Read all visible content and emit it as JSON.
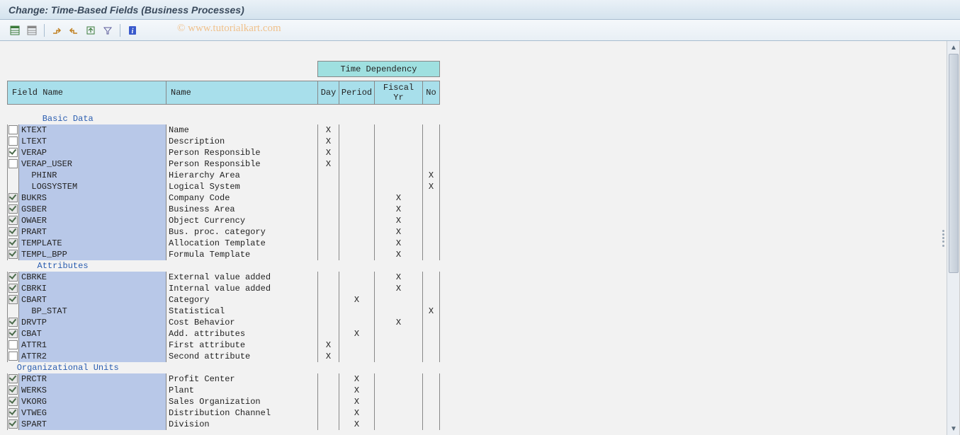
{
  "title": "Change: Time-Based Fields (Business Processes)",
  "watermark": "©   www.tutorialkart.com",
  "headers": {
    "dependency": "Time Dependency",
    "field": "Field Name",
    "name": "Name",
    "day": "Day",
    "period": "Period",
    "fiscal": "Fiscal Yr",
    "no": "No"
  },
  "sections": [
    {
      "title": "Basic Data",
      "indent": "      ",
      "rows": [
        {
          "cb": "unchecked",
          "field": "KTEXT",
          "name": "Name",
          "day": "X",
          "period": "",
          "fy": "",
          "no": ""
        },
        {
          "cb": "unchecked",
          "field": "LTEXT",
          "name": "Description",
          "day": "X",
          "period": "",
          "fy": "",
          "no": ""
        },
        {
          "cb": "checked",
          "field": "VERAP",
          "name": "Person Responsible",
          "day": "X",
          "period": "",
          "fy": "",
          "no": ""
        },
        {
          "cb": "unchecked",
          "field": "VERAP_USER",
          "name": "Person Responsible",
          "day": "X",
          "period": "",
          "fy": "",
          "no": ""
        },
        {
          "cb": "none",
          "field": "  PHINR",
          "name": "Hierarchy Area",
          "day": "",
          "period": "",
          "fy": "",
          "no": "X"
        },
        {
          "cb": "none",
          "field": "  LOGSYSTEM",
          "name": "Logical System",
          "day": "",
          "period": "",
          "fy": "",
          "no": "X"
        },
        {
          "cb": "checked-disabled",
          "field": "BUKRS",
          "name": "Company Code",
          "day": "",
          "period": "",
          "fy": "X",
          "no": ""
        },
        {
          "cb": "checked-disabled",
          "field": "GSBER",
          "name": "Business Area",
          "day": "",
          "period": "",
          "fy": "X",
          "no": ""
        },
        {
          "cb": "checked-disabled",
          "field": "OWAER",
          "name": "Object Currency",
          "day": "",
          "period": "",
          "fy": "X",
          "no": ""
        },
        {
          "cb": "checked-disabled",
          "field": "PRART",
          "name": "Bus. proc. category",
          "day": "",
          "period": "",
          "fy": "X",
          "no": ""
        },
        {
          "cb": "checked-disabled",
          "field": "TEMPLATE",
          "name": "Allocation Template",
          "day": "",
          "period": "",
          "fy": "X",
          "no": ""
        },
        {
          "cb": "checked-disabled",
          "field": "TEMPL_BPP",
          "name": "Formula Template",
          "day": "",
          "period": "",
          "fy": "X",
          "no": ""
        }
      ]
    },
    {
      "title": "Attributes",
      "indent": "     ",
      "rows": [
        {
          "cb": "checked-disabled",
          "field": "CBRKE",
          "name": "External value added",
          "day": "",
          "period": "",
          "fy": "X",
          "no": ""
        },
        {
          "cb": "checked-disabled",
          "field": "CBRKI",
          "name": "Internal value added",
          "day": "",
          "period": "",
          "fy": "X",
          "no": ""
        },
        {
          "cb": "checked-disabled",
          "field": "CBART",
          "name": "Category",
          "day": "",
          "period": "X",
          "fy": "",
          "no": ""
        },
        {
          "cb": "none",
          "field": "  BP_STAT",
          "name": "Statistical",
          "day": "",
          "period": "",
          "fy": "",
          "no": "X"
        },
        {
          "cb": "checked-disabled",
          "field": "DRVTP",
          "name": "Cost Behavior",
          "day": "",
          "period": "",
          "fy": "X",
          "no": ""
        },
        {
          "cb": "checked-disabled",
          "field": "CBAT",
          "name": "Add. attributes",
          "day": "",
          "period": "X",
          "fy": "",
          "no": ""
        },
        {
          "cb": "unchecked",
          "field": "ATTR1",
          "name": "First attribute",
          "day": "X",
          "period": "",
          "fy": "",
          "no": ""
        },
        {
          "cb": "unchecked",
          "field": "ATTR2",
          "name": "Second attribute",
          "day": "X",
          "period": "",
          "fy": "",
          "no": ""
        }
      ]
    },
    {
      "title": "Organizational Units",
      "indent": " ",
      "rows": [
        {
          "cb": "checked-disabled",
          "field": "PRCTR",
          "name": "Profit Center",
          "day": "",
          "period": "X",
          "fy": "",
          "no": ""
        },
        {
          "cb": "checked-disabled",
          "field": "WERKS",
          "name": "Plant",
          "day": "",
          "period": "X",
          "fy": "",
          "no": ""
        },
        {
          "cb": "checked-disabled",
          "field": "VKORG",
          "name": "Sales Organization",
          "day": "",
          "period": "X",
          "fy": "",
          "no": ""
        },
        {
          "cb": "checked-disabled",
          "field": "VTWEG",
          "name": "Distribution Channel",
          "day": "",
          "period": "X",
          "fy": "",
          "no": ""
        },
        {
          "cb": "checked-disabled",
          "field": "SPART",
          "name": "Division",
          "day": "",
          "period": "X",
          "fy": "",
          "no": ""
        }
      ]
    }
  ]
}
